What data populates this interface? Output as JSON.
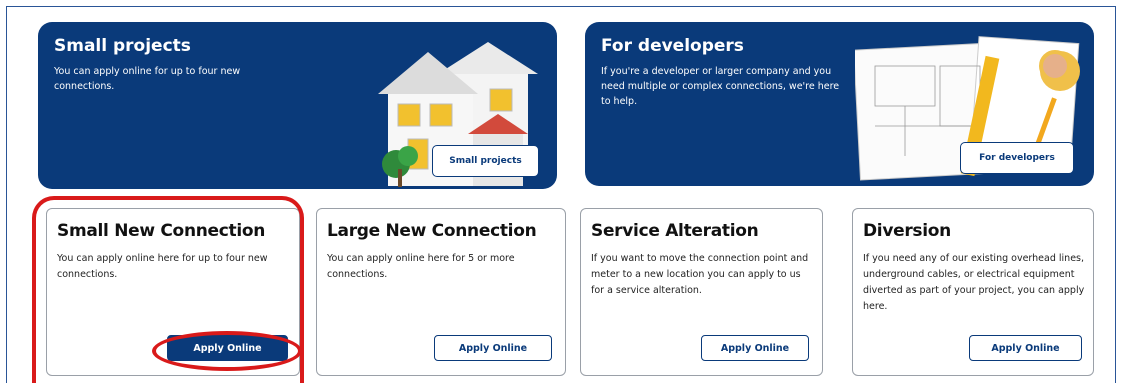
{
  "banners": [
    {
      "title": "Small projects",
      "text": "You can apply online for up to four new connections.",
      "button": "Small projects",
      "illustration": "house-icon"
    },
    {
      "title": "For developers",
      "text": "If you're a developer or larger company and you need multiple or complex connections, we're here to help.",
      "button": "For developers",
      "illustration": "blueprint-icon"
    }
  ],
  "cards": [
    {
      "title": "Small New Connection",
      "text": "You can apply online here for up to four new connections.",
      "button": "Apply Online",
      "highlighted": true
    },
    {
      "title": "Large New Connection",
      "text": "You can apply online here for 5 or more connections.",
      "button": "Apply Online"
    },
    {
      "title": "Service Alteration",
      "text": "If you want to move the connection point and meter to a new location you can apply to us for a service alteration.",
      "button": "Apply Online"
    },
    {
      "title": "Diversion",
      "text": "If you need any of our existing overhead lines, underground cables, or electrical equipment diverted as part of your project, you can apply here.",
      "button": "Apply Online"
    }
  ],
  "colors": {
    "brand": "#0a3a7a",
    "annotation": "#d91a1a"
  }
}
